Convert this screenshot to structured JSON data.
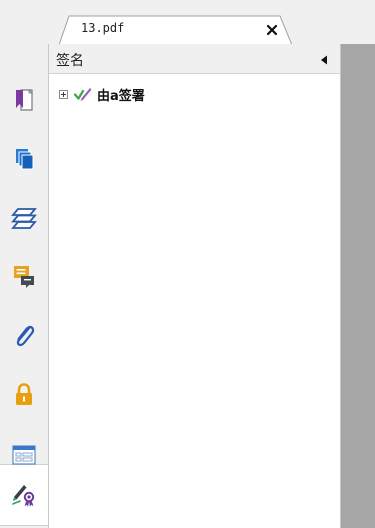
{
  "tab": {
    "title": "13.pdf",
    "close_icon": "close-icon"
  },
  "panel": {
    "title": "签名",
    "collapse_icon": "triangle-left-icon"
  },
  "tree": {
    "items": [
      {
        "label": "由a签署",
        "expanded": false,
        "icon": "valid-signature-icon"
      }
    ]
  },
  "rail": {
    "items": [
      {
        "name": "bookmark",
        "icon": "bookmark-icon",
        "active": false
      },
      {
        "name": "pages",
        "icon": "pages-thumbnail-icon",
        "active": false
      },
      {
        "name": "layers",
        "icon": "layers-icon",
        "active": false
      },
      {
        "name": "comments",
        "icon": "comment-icon",
        "active": false
      },
      {
        "name": "attachments",
        "icon": "paperclip-icon",
        "active": false
      },
      {
        "name": "security",
        "icon": "lock-icon",
        "active": false
      },
      {
        "name": "form",
        "icon": "form-fields-icon",
        "active": false
      },
      {
        "name": "signatures",
        "icon": "signature-panel-icon",
        "active": true
      }
    ]
  },
  "colors": {
    "bookmark": "#7a3aa0",
    "pages": "#1e6fc8",
    "layers": "#2a5aa8",
    "comment": "#e5a320",
    "attachment": "#2a5ab8",
    "lock": "#e8a010",
    "doc_area": "#a6a6a6"
  }
}
